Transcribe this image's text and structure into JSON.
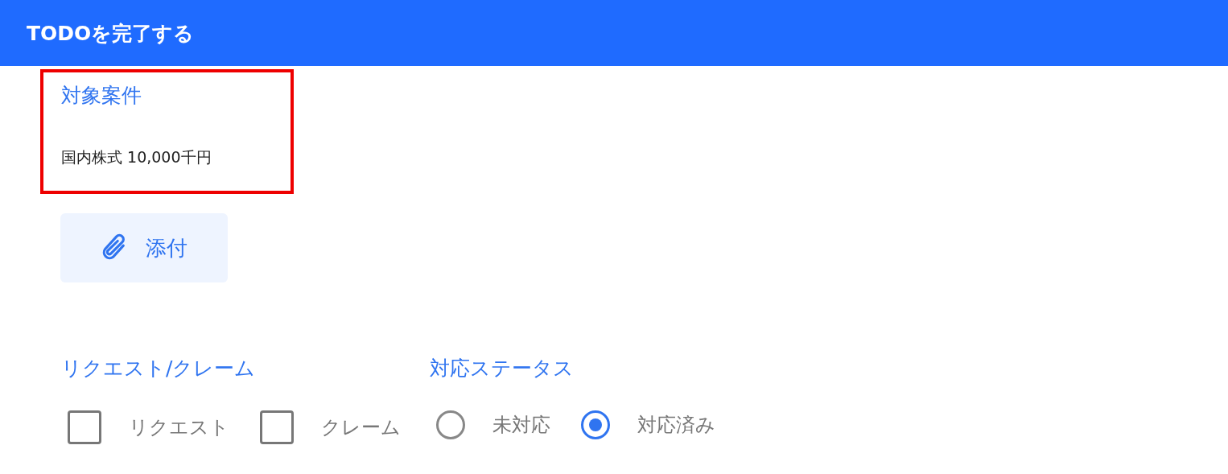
{
  "header": {
    "title": "TODOを完了する"
  },
  "target": {
    "label": "対象案件",
    "value": "国内株式 10,000千円",
    "highlighted": true
  },
  "attach_button": {
    "label": "添付"
  },
  "groups": [
    {
      "label": "リクエスト/クレーム",
      "kind": "checkbox",
      "options": [
        {
          "label": "リクエスト",
          "checked": false
        },
        {
          "label": "クレーム",
          "checked": false
        }
      ]
    },
    {
      "label": "対応ステータス",
      "kind": "radio",
      "options": [
        {
          "label": "未対応",
          "selected": false
        },
        {
          "label": "対応済み",
          "selected": true
        }
      ]
    }
  ]
}
